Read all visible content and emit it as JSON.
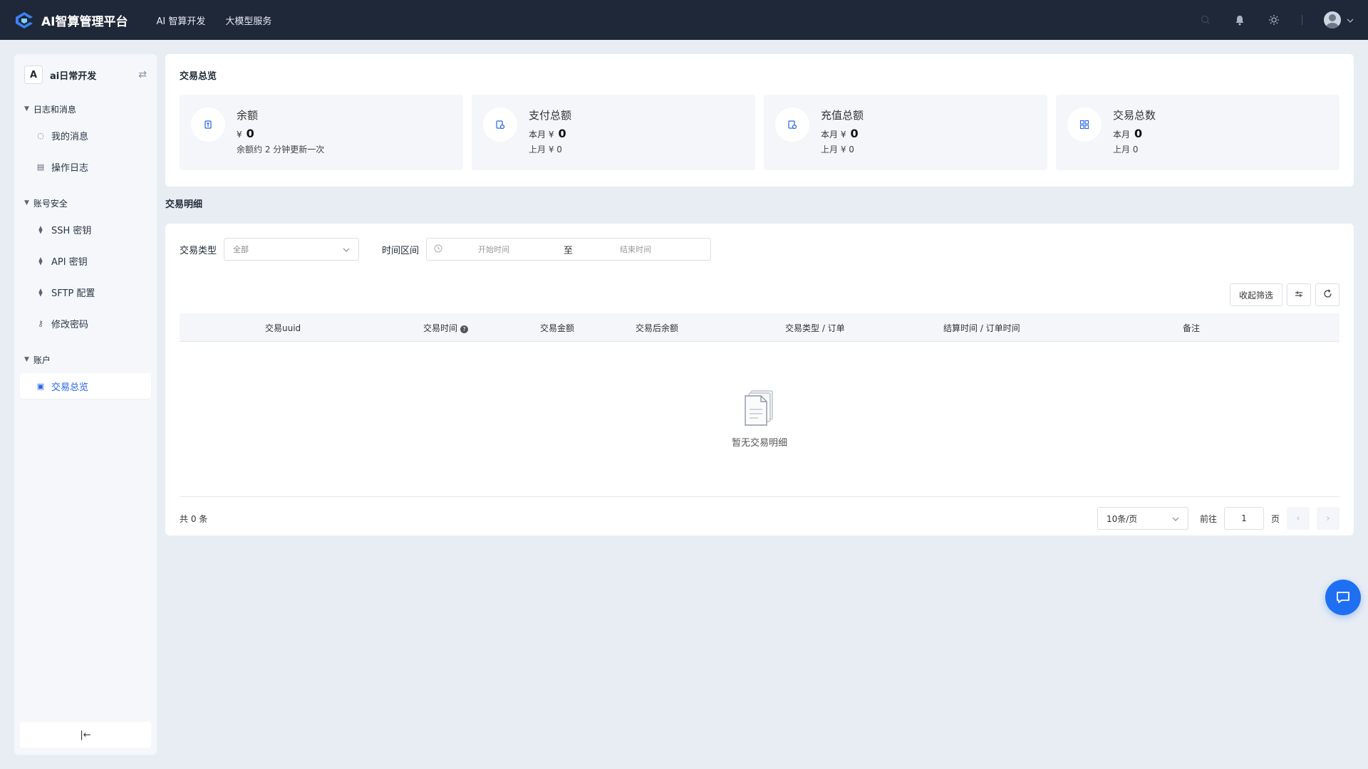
{
  "app": {
    "title": "AI智算管理平台",
    "nav": [
      "AI 智算开发",
      "大模型服务"
    ]
  },
  "sidebar": {
    "workspace_badge": "A",
    "workspace_name": "ai日常开发",
    "switch_icon": "⇄",
    "groups": [
      {
        "title": "日志和消息",
        "items": [
          {
            "label": "我的消息",
            "icon": "message-icon"
          },
          {
            "label": "操作日志",
            "icon": "clipboard-icon"
          }
        ]
      },
      {
        "title": "账号安全",
        "items": [
          {
            "label": "SSH 密钥",
            "icon": "key-icon"
          },
          {
            "label": "API 密钥",
            "icon": "key-icon"
          },
          {
            "label": "SFTP 配置",
            "icon": "key-icon"
          },
          {
            "label": "修改密码",
            "icon": "gender-key-icon"
          }
        ]
      },
      {
        "title": "账户",
        "items": [
          {
            "label": "交易总览",
            "icon": "receipt-icon",
            "active": true
          }
        ]
      }
    ],
    "collapse_label": "|←"
  },
  "overview": {
    "title": "交易总览",
    "cards": [
      {
        "name": "余额",
        "main_label": "¥",
        "main_value": "0",
        "sub": "余额约 2 分钟更新一次"
      },
      {
        "name": "支付总额",
        "main_label": "本月  ¥",
        "main_value": "0",
        "sub": "上月  ¥  0"
      },
      {
        "name": "充值总额",
        "main_label": "本月  ¥",
        "main_value": "0",
        "sub": "上月  ¥  0"
      },
      {
        "name": "交易总数",
        "main_label": "本月",
        "main_value": "0",
        "sub": "上月  0"
      }
    ]
  },
  "detail": {
    "title": "交易明细",
    "filters": {
      "type_label": "交易类型",
      "type_value": "全部",
      "range_label": "时间区间",
      "start_placeholder": "开始时间",
      "to": "至",
      "end_placeholder": "结束时间"
    },
    "actions": {
      "collapse_filter": "收起筛选"
    },
    "columns": [
      "交易uuid",
      "交易时间",
      "交易金额",
      "交易后余额",
      "交易类型 / 订单",
      "结算时间 / 订单时间",
      "备注"
    ],
    "empty_text": "暂无交易明细",
    "pager": {
      "total": "共 0 条",
      "page_size": "10条/页",
      "goto": "前往",
      "page": "1",
      "page_unit": "页"
    }
  },
  "colors": {
    "topbar": "#1f2838",
    "accent": "#2563eb",
    "fab": "#1f6ff2"
  }
}
